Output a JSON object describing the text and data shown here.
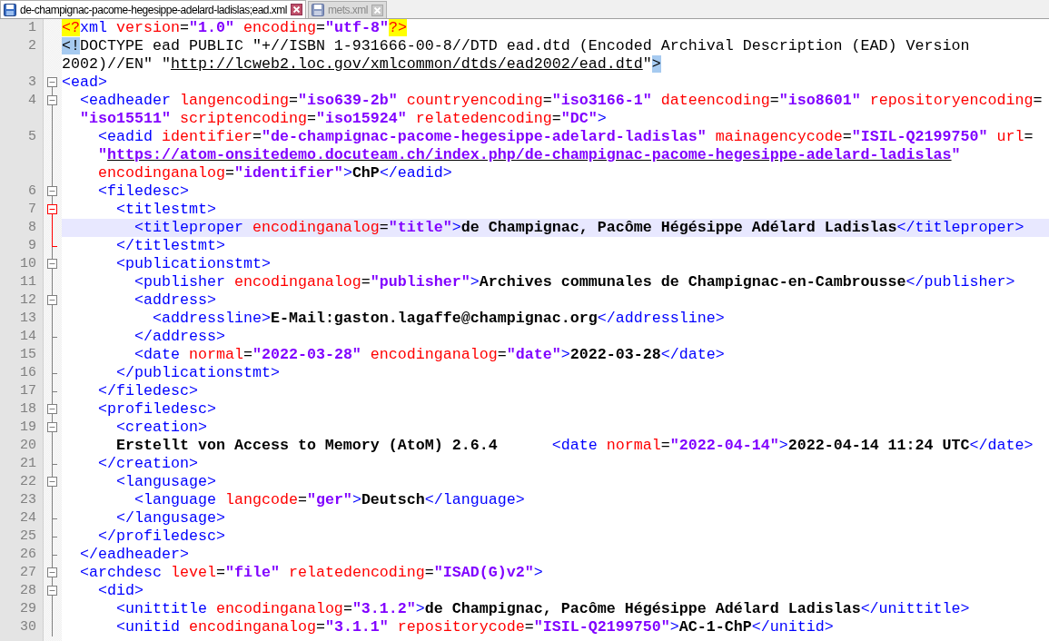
{
  "tabs": [
    {
      "label": "de-champignac-pacome-hegesippe-adelard-ladislas;ead.xml",
      "selected": true
    },
    {
      "label": "mets.xml",
      "selected": false
    }
  ],
  "lines": [
    {
      "number": "1",
      "kind": "plain",
      "current": false,
      "parts": [
        {
          "segments": [
            {
              "kind": "pi",
              "text": "<?"
            },
            {
              "kind": "tag",
              "text": "xml"
            },
            {
              "kind": "attr",
              "text": " version"
            },
            {
              "kind": "plain",
              "text": "="
            },
            {
              "kind": "value",
              "text": "\"1.0\""
            },
            {
              "kind": "attr",
              "text": " encoding"
            },
            {
              "kind": "plain",
              "text": "="
            },
            {
              "kind": "value",
              "text": "\"utf-8\""
            },
            {
              "kind": "pi",
              "text": "?>"
            }
          ]
        }
      ]
    },
    {
      "number": "2",
      "kind": "plain",
      "current": false,
      "parts": [
        {
          "segments": [
            {
              "kind": "mark",
              "text": "<!"
            },
            {
              "kind": "plain",
              "text": "DOCTYPE ead PUBLIC \"+//ISBN 1-931666-00-8//DTD ead.dtd (Encoded Archival Description (EAD) Version"
            }
          ]
        },
        {
          "segments": [
            {
              "kind": "plain",
              "text": "2002)//EN\" \""
            },
            {
              "kind": "plain-link",
              "text": "http://lcweb2.loc.gov/xmlcommon/dtds/ead2002/ead.dtd"
            },
            {
              "kind": "plain",
              "text": "\""
            },
            {
              "kind": "mark",
              "text": ">"
            }
          ]
        }
      ]
    },
    {
      "number": "3",
      "kind": "open",
      "active": false,
      "current": false,
      "parts": [
        {
          "segments": [
            {
              "kind": "tag",
              "text": "<ead>"
            }
          ]
        }
      ]
    },
    {
      "number": "4",
      "kind": "open",
      "active": false,
      "current": false,
      "parts": [
        {
          "segments": [
            {
              "kind": "tag",
              "text": "  <eadheader"
            },
            {
              "kind": "attr",
              "text": " langencoding"
            },
            {
              "kind": "plain",
              "text": "="
            },
            {
              "kind": "value",
              "text": "\"iso639-2b\""
            },
            {
              "kind": "attr",
              "text": " countryencoding"
            },
            {
              "kind": "plain",
              "text": "="
            },
            {
              "kind": "value",
              "text": "\"iso3166-1\""
            },
            {
              "kind": "attr",
              "text": " dateencoding"
            },
            {
              "kind": "plain",
              "text": "="
            },
            {
              "kind": "value",
              "text": "\"iso8601\""
            },
            {
              "kind": "attr",
              "text": " repositoryencoding"
            },
            {
              "kind": "plain",
              "text": "="
            }
          ]
        },
        {
          "segments": [
            {
              "kind": "value",
              "text": "  \"iso15511\""
            },
            {
              "kind": "attr",
              "text": " scriptencoding"
            },
            {
              "kind": "plain",
              "text": "="
            },
            {
              "kind": "value",
              "text": "\"iso15924\""
            },
            {
              "kind": "attr",
              "text": " relatedencoding"
            },
            {
              "kind": "plain",
              "text": "="
            },
            {
              "kind": "value",
              "text": "\"DC\""
            },
            {
              "kind": "tag",
              "text": ">"
            }
          ]
        }
      ]
    },
    {
      "number": "5",
      "kind": "inner",
      "active": false,
      "current": false,
      "parts": [
        {
          "segments": [
            {
              "kind": "tag",
              "text": "    <eadid"
            },
            {
              "kind": "attr",
              "text": " identifier"
            },
            {
              "kind": "plain",
              "text": "="
            },
            {
              "kind": "value",
              "text": "\"de-champignac-pacome-hegesippe-adelard-ladislas\""
            },
            {
              "kind": "attr",
              "text": " mainagencycode"
            },
            {
              "kind": "plain",
              "text": "="
            },
            {
              "kind": "value",
              "text": "\"ISIL-Q2199750\""
            },
            {
              "kind": "attr",
              "text": " url"
            },
            {
              "kind": "plain",
              "text": "="
            }
          ]
        },
        {
          "segments": [
            {
              "kind": "value",
              "text": "    \""
            },
            {
              "kind": "value-link",
              "text": "https://atom-onsitedemo.docuteam.ch/index.php/de-champignac-pacome-hegesippe-adelard-ladislas"
            },
            {
              "kind": "value",
              "text": "\""
            }
          ]
        },
        {
          "segments": [
            {
              "kind": "attr",
              "text": "    encodinganalog"
            },
            {
              "kind": "plain",
              "text": "="
            },
            {
              "kind": "value",
              "text": "\"identifier\""
            },
            {
              "kind": "tag",
              "text": ">"
            },
            {
              "kind": "text",
              "text": "ChP"
            },
            {
              "kind": "tag",
              "text": "</eadid>"
            }
          ]
        }
      ]
    },
    {
      "number": "6",
      "kind": "open",
      "active": false,
      "current": false,
      "parts": [
        {
          "segments": [
            {
              "kind": "tag",
              "text": "    <filedesc>"
            }
          ]
        }
      ]
    },
    {
      "number": "7",
      "kind": "open",
      "active": true,
      "current": false,
      "parts": [
        {
          "segments": [
            {
              "kind": "tag",
              "text": "      <titlestmt>"
            }
          ]
        }
      ]
    },
    {
      "number": "8",
      "kind": "inner",
      "active": true,
      "current": true,
      "parts": [
        {
          "segments": [
            {
              "kind": "tag",
              "text": "        <titleproper"
            },
            {
              "kind": "attr",
              "text": " encodinganalog"
            },
            {
              "kind": "plain",
              "text": "="
            },
            {
              "kind": "value",
              "text": "\"title\""
            },
            {
              "kind": "tag",
              "text": ">"
            },
            {
              "kind": "text",
              "text": "de Champignac, Pacôme Hégésippe Adélard Ladislas"
            },
            {
              "kind": "tag",
              "text": "</titleproper>"
            }
          ]
        }
      ]
    },
    {
      "number": "9",
      "kind": "close",
      "active": true,
      "current": false,
      "parts": [
        {
          "segments": [
            {
              "kind": "tag",
              "text": "      </titlestmt>"
            }
          ]
        }
      ]
    },
    {
      "number": "10",
      "kind": "open",
      "active": false,
      "current": false,
      "parts": [
        {
          "segments": [
            {
              "kind": "tag",
              "text": "      <publicationstmt>"
            }
          ]
        }
      ]
    },
    {
      "number": "11",
      "kind": "inner",
      "active": false,
      "current": false,
      "parts": [
        {
          "segments": [
            {
              "kind": "tag",
              "text": "        <publisher"
            },
            {
              "kind": "attr",
              "text": " encodinganalog"
            },
            {
              "kind": "plain",
              "text": "="
            },
            {
              "kind": "value",
              "text": "\"publisher\""
            },
            {
              "kind": "tag",
              "text": ">"
            },
            {
              "kind": "text",
              "text": "Archives communales de Champignac-en-Cambrousse"
            },
            {
              "kind": "tag",
              "text": "</publisher>"
            }
          ]
        }
      ]
    },
    {
      "number": "12",
      "kind": "open",
      "active": false,
      "current": false,
      "parts": [
        {
          "segments": [
            {
              "kind": "tag",
              "text": "        <address>"
            }
          ]
        }
      ]
    },
    {
      "number": "13",
      "kind": "inner",
      "active": false,
      "current": false,
      "parts": [
        {
          "segments": [
            {
              "kind": "tag",
              "text": "          <addressline>"
            },
            {
              "kind": "text",
              "text": "E-Mail:gaston.lagaffe@champignac.org"
            },
            {
              "kind": "tag",
              "text": "</addressline>"
            }
          ]
        }
      ]
    },
    {
      "number": "14",
      "kind": "close",
      "active": false,
      "current": false,
      "parts": [
        {
          "segments": [
            {
              "kind": "tag",
              "text": "        </address>"
            }
          ]
        }
      ]
    },
    {
      "number": "15",
      "kind": "inner",
      "active": false,
      "current": false,
      "parts": [
        {
          "segments": [
            {
              "kind": "tag",
              "text": "        <date"
            },
            {
              "kind": "attr",
              "text": " normal"
            },
            {
              "kind": "plain",
              "text": "="
            },
            {
              "kind": "value",
              "text": "\"2022-03-28\""
            },
            {
              "kind": "attr",
              "text": " encodinganalog"
            },
            {
              "kind": "plain",
              "text": "="
            },
            {
              "kind": "value",
              "text": "\"date\""
            },
            {
              "kind": "tag",
              "text": ">"
            },
            {
              "kind": "text",
              "text": "2022-03-28"
            },
            {
              "kind": "tag",
              "text": "</date>"
            }
          ]
        }
      ]
    },
    {
      "number": "16",
      "kind": "close",
      "active": false,
      "current": false,
      "parts": [
        {
          "segments": [
            {
              "kind": "tag",
              "text": "      </publicationstmt>"
            }
          ]
        }
      ]
    },
    {
      "number": "17",
      "kind": "close",
      "active": false,
      "current": false,
      "parts": [
        {
          "segments": [
            {
              "kind": "tag",
              "text": "    </filedesc>"
            }
          ]
        }
      ]
    },
    {
      "number": "18",
      "kind": "open",
      "active": false,
      "current": false,
      "parts": [
        {
          "segments": [
            {
              "kind": "tag",
              "text": "    <profiledesc>"
            }
          ]
        }
      ]
    },
    {
      "number": "19",
      "kind": "open",
      "active": false,
      "current": false,
      "parts": [
        {
          "segments": [
            {
              "kind": "tag",
              "text": "      <creation>"
            }
          ]
        }
      ]
    },
    {
      "number": "20",
      "kind": "inner",
      "active": false,
      "current": false,
      "parts": [
        {
          "segments": [
            {
              "kind": "text",
              "text": "      Erstellt von Access to Memory (AtoM) 2.6.4      "
            },
            {
              "kind": "tag",
              "text": "<date"
            },
            {
              "kind": "attr",
              "text": " normal"
            },
            {
              "kind": "plain",
              "text": "="
            },
            {
              "kind": "value",
              "text": "\"2022-04-14\""
            },
            {
              "kind": "tag",
              "text": ">"
            },
            {
              "kind": "text",
              "text": "2022-04-14 11:24 UTC"
            },
            {
              "kind": "tag",
              "text": "</date>"
            }
          ]
        }
      ]
    },
    {
      "number": "21",
      "kind": "close",
      "active": false,
      "current": false,
      "parts": [
        {
          "segments": [
            {
              "kind": "tag",
              "text": "    </creation>"
            }
          ]
        }
      ]
    },
    {
      "number": "22",
      "kind": "open",
      "active": false,
      "current": false,
      "parts": [
        {
          "segments": [
            {
              "kind": "tag",
              "text": "      <langusage>"
            }
          ]
        }
      ]
    },
    {
      "number": "23",
      "kind": "inner",
      "active": false,
      "current": false,
      "parts": [
        {
          "segments": [
            {
              "kind": "tag",
              "text": "        <language"
            },
            {
              "kind": "attr",
              "text": " langcode"
            },
            {
              "kind": "plain",
              "text": "="
            },
            {
              "kind": "value",
              "text": "\"ger\""
            },
            {
              "kind": "tag",
              "text": ">"
            },
            {
              "kind": "text",
              "text": "Deutsch"
            },
            {
              "kind": "tag",
              "text": "</language>"
            }
          ]
        }
      ]
    },
    {
      "number": "24",
      "kind": "close",
      "active": false,
      "current": false,
      "parts": [
        {
          "segments": [
            {
              "kind": "tag",
              "text": "      </langusage>"
            }
          ]
        }
      ]
    },
    {
      "number": "25",
      "kind": "close",
      "active": false,
      "current": false,
      "parts": [
        {
          "segments": [
            {
              "kind": "tag",
              "text": "    </profiledesc>"
            }
          ]
        }
      ]
    },
    {
      "number": "26",
      "kind": "close",
      "active": false,
      "current": false,
      "parts": [
        {
          "segments": [
            {
              "kind": "tag",
              "text": "  </eadheader>"
            }
          ]
        }
      ]
    },
    {
      "number": "27",
      "kind": "open",
      "active": false,
      "current": false,
      "parts": [
        {
          "segments": [
            {
              "kind": "tag",
              "text": "  <archdesc"
            },
            {
              "kind": "attr",
              "text": " level"
            },
            {
              "kind": "plain",
              "text": "="
            },
            {
              "kind": "value",
              "text": "\"file\""
            },
            {
              "kind": "attr",
              "text": " relatedencoding"
            },
            {
              "kind": "plain",
              "text": "="
            },
            {
              "kind": "value",
              "text": "\"ISAD(G)v2\""
            },
            {
              "kind": "tag",
              "text": ">"
            }
          ]
        }
      ]
    },
    {
      "number": "28",
      "kind": "open",
      "active": false,
      "current": false,
      "parts": [
        {
          "segments": [
            {
              "kind": "tag",
              "text": "    <did>"
            }
          ]
        }
      ]
    },
    {
      "number": "29",
      "kind": "inner",
      "active": false,
      "current": false,
      "parts": [
        {
          "segments": [
            {
              "kind": "tag",
              "text": "      <unittitle"
            },
            {
              "kind": "attr",
              "text": " encodinganalog"
            },
            {
              "kind": "plain",
              "text": "="
            },
            {
              "kind": "value",
              "text": "\"3.1.2\""
            },
            {
              "kind": "tag",
              "text": ">"
            },
            {
              "kind": "text",
              "text": "de Champignac, Pacôme Hégésippe Adélard Ladislas"
            },
            {
              "kind": "tag",
              "text": "</unittitle>"
            }
          ]
        }
      ]
    },
    {
      "number": "30",
      "kind": "inner",
      "active": false,
      "current": false,
      "parts": [
        {
          "segments": [
            {
              "kind": "tag",
              "text": "      <unitid"
            },
            {
              "kind": "attr",
              "text": " encodinganalog"
            },
            {
              "kind": "plain",
              "text": "="
            },
            {
              "kind": "value",
              "text": "\"3.1.1\""
            },
            {
              "kind": "attr",
              "text": " repositorycode"
            },
            {
              "kind": "plain",
              "text": "="
            },
            {
              "kind": "value",
              "text": "\"ISIL-Q2199750\""
            },
            {
              "kind": "tag",
              "text": ">"
            },
            {
              "kind": "text",
              "text": "AC-1-ChP"
            },
            {
              "kind": "tag",
              "text": "</unitid>"
            }
          ]
        }
      ]
    }
  ]
}
